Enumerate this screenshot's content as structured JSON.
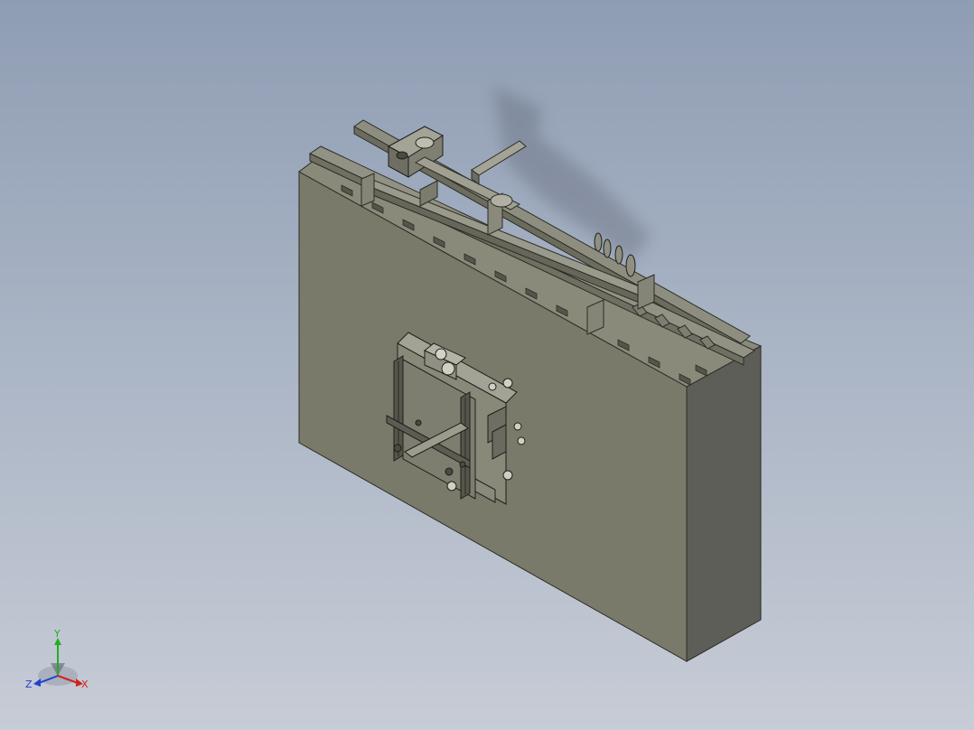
{
  "viewport": {
    "background_top": "#8f9db3",
    "background_bottom": "#c7ccd6",
    "model_color": "#7a7a6a"
  },
  "triad": {
    "x_label": "X",
    "y_label": "Y",
    "z_label": "Z",
    "x_color": "#d42020",
    "y_color": "#20b020",
    "z_color": "#2040d0"
  }
}
